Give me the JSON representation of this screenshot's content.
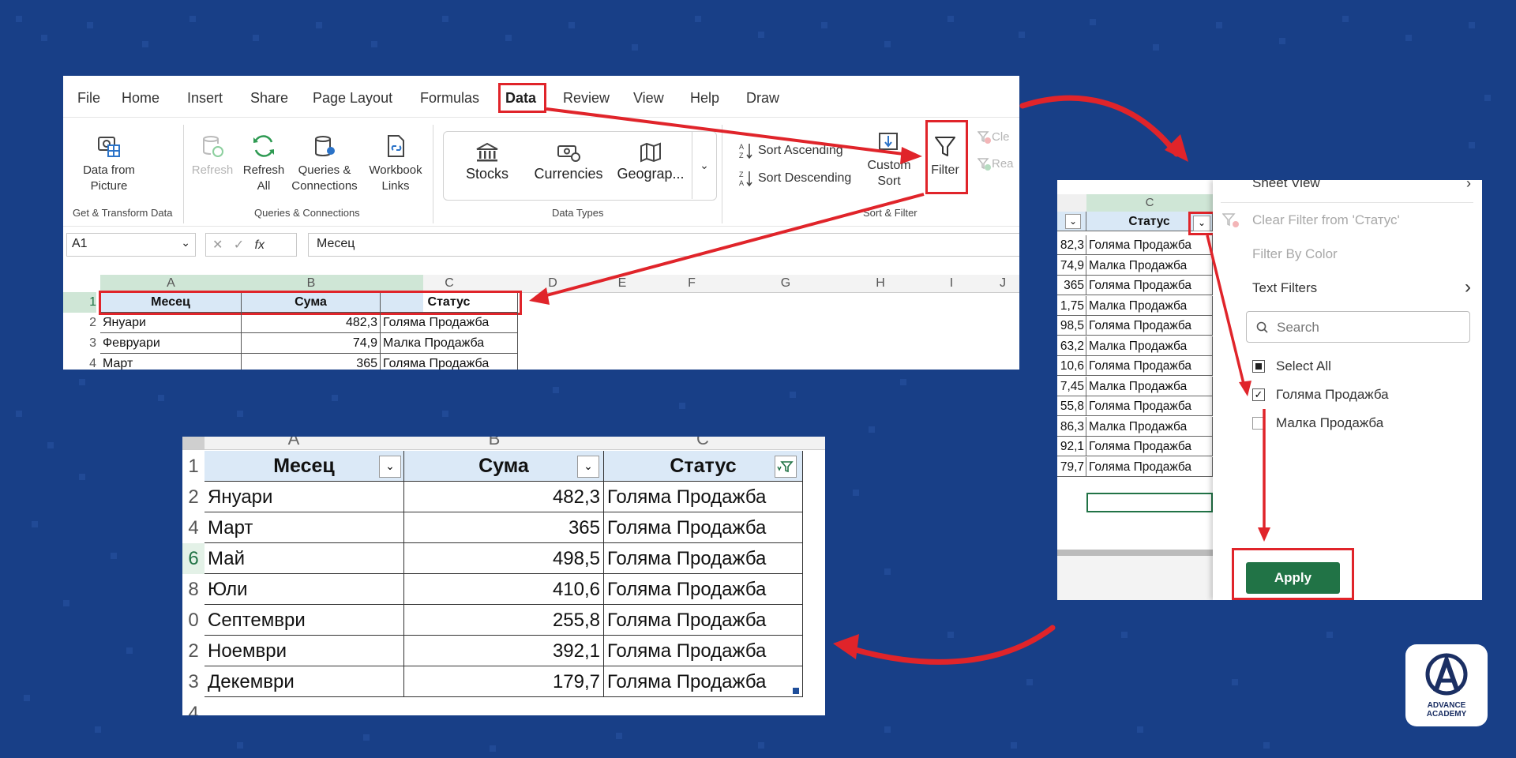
{
  "ribbon": {
    "menu_tabs": [
      "File",
      "Home",
      "Insert",
      "Share",
      "Page Layout",
      "Formulas",
      "Data",
      "Review",
      "View",
      "Help",
      "Draw"
    ],
    "get_transform": {
      "data_from_picture": "Data from Picture",
      "group_label": "Get & Transform Data"
    },
    "queries": {
      "refresh": "Refresh",
      "refresh_all": "Refresh All",
      "queries_connections": "Queries & Connections",
      "workbook_links": "Workbook Links",
      "group_label": "Queries & Connections"
    },
    "data_types": {
      "stocks": "Stocks",
      "currencies": "Currencies",
      "geography": "Geograp...",
      "group_label": "Data Types"
    },
    "sort_filter": {
      "sort_ascending": "Sort Ascending",
      "sort_descending": "Sort Descending",
      "custom_sort": "Custom Sort",
      "filter": "Filter",
      "clear": "Cle",
      "reapply": "Rea",
      "group_label": "Sort & Filter"
    },
    "formula_bar": {
      "name_box": "A1",
      "fx": "fx",
      "value": "Месец"
    }
  },
  "sheet1": {
    "col_letters": [
      "A",
      "B",
      "C",
      "D",
      "E",
      "F",
      "G",
      "H",
      "I",
      "J"
    ],
    "rows": [
      {
        "num": "1",
        "a": "Месец",
        "b": "Сума",
        "c": "Статус"
      },
      {
        "num": "2",
        "a": "Януари",
        "b": "482,3",
        "c": "Голяма Продажба"
      },
      {
        "num": "3",
        "a": "Февруари",
        "b": "74,9",
        "c": "Малка Продажба"
      },
      {
        "num": "4",
        "a": "Март",
        "b": "365",
        "c": "Голяма Продажба"
      }
    ]
  },
  "filter_panel": {
    "col_letter": "C",
    "header": "Статус",
    "rows": [
      {
        "val": "82,3",
        "status": "Голяма Продажба"
      },
      {
        "val": "74,9",
        "status": "Малка Продажба"
      },
      {
        "val": "365",
        "status": "Голяма Продажба"
      },
      {
        "val": "1,75",
        "status": "Малка Продажба"
      },
      {
        "val": "98,5",
        "status": "Голяма Продажба"
      },
      {
        "val": "63,2",
        "status": "Малка Продажба"
      },
      {
        "val": "10,6",
        "status": "Голяма Продажба"
      },
      {
        "val": "7,45",
        "status": "Малка Продажба"
      },
      {
        "val": "55,8",
        "status": "Голяма Продажба"
      },
      {
        "val": "86,3",
        "status": "Малка Продажба"
      },
      {
        "val": "92,1",
        "status": "Голяма Продажба"
      },
      {
        "val": "79,7",
        "status": "Голяма Продажба"
      }
    ],
    "menu": {
      "sheet_view": "Sheet View",
      "clear_filter": "Clear Filter from 'Статус'",
      "filter_by_color": "Filter By Color",
      "text_filters": "Text Filters",
      "search_placeholder": "Search",
      "select_all": "Select All",
      "option1": "Голяма Продажба",
      "option2": "Малка Продажба",
      "apply": "Apply"
    }
  },
  "result": {
    "col_letters": [
      "A",
      "B",
      "C"
    ],
    "headers": [
      "Месец",
      "Сума",
      "Статус"
    ],
    "rows": [
      {
        "num": "2",
        "a": "Януари",
        "b": "482,3",
        "c": "Голяма Продажба"
      },
      {
        "num": "4",
        "a": "Март",
        "b": "365",
        "c": "Голяма Продажба"
      },
      {
        "num": "6",
        "a": "Май",
        "b": "498,5",
        "c": "Голяма Продажба"
      },
      {
        "num": "8",
        "a": "Юли",
        "b": "410,6",
        "c": "Голяма Продажба"
      },
      {
        "num": "0",
        "a": "Септември",
        "b": "255,8",
        "c": "Голяма Продажба"
      },
      {
        "num": "2",
        "a": "Ноември",
        "b": "392,1",
        "c": "Голяма Продажба"
      },
      {
        "num": "3",
        "a": "Декември",
        "b": "179,7",
        "c": "Голяма Продажба"
      }
    ],
    "header_row_num": "1",
    "last_row_num": "4"
  },
  "logo": {
    "text_line1": "ADVANCE",
    "text_line2": "ACADEMY"
  },
  "colors": {
    "background": "#183f87",
    "accent_red": "#e0242a",
    "excel_green": "#217346",
    "header_fill": "#dbe9f7"
  }
}
